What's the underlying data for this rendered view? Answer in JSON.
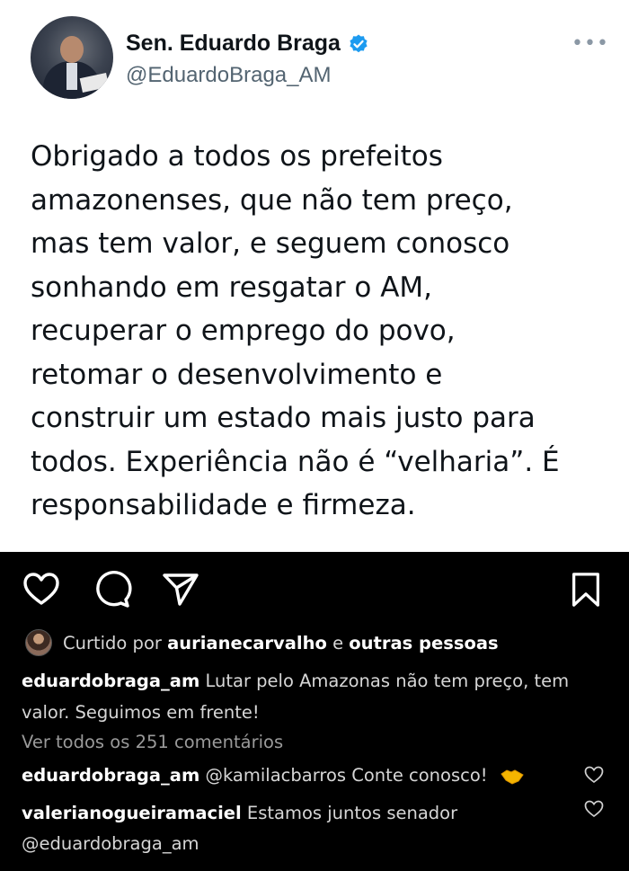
{
  "tweet": {
    "display_name": "Sen. Eduardo Braga",
    "handle": "@EduardoBraga_AM",
    "more_glyph": "•••",
    "text": "Obrigado a todos os prefeitos\namazonenses, que não tem preço,\nmas tem valor, e seguem conosco\nsonhando em resgatar o AM,\nrecuperar o emprego do povo,\nretomar o desenvolvimento e\nconstruir um estado mais justo para\ntodos. Experiência não é “velharia”. É\nresponsabilidade e firmeza.",
    "verified_color": "#1d9bf0"
  },
  "instagram": {
    "liked_prefix": "Curtido por",
    "liked_user": "aurianecarvalho",
    "liked_and": "e",
    "liked_others": "outras pessoas",
    "caption_user": "eduardobraga_am",
    "caption_text": "Lutar pelo Amazonas não tem preço, tem valor. Seguimos em frente!",
    "view_all": "Ver todos os 251 comentários",
    "comments": [
      {
        "user": "eduardobraga_am",
        "text": "@kamilacbarros Conte conosco!",
        "emoji": "handshake-icon"
      },
      {
        "user": "valerianogueiramaciel",
        "text": "Estamos juntos senador @eduardobraga_am"
      }
    ],
    "icons": [
      "heart-icon",
      "comment-icon",
      "share-icon",
      "bookmark-icon"
    ]
  }
}
